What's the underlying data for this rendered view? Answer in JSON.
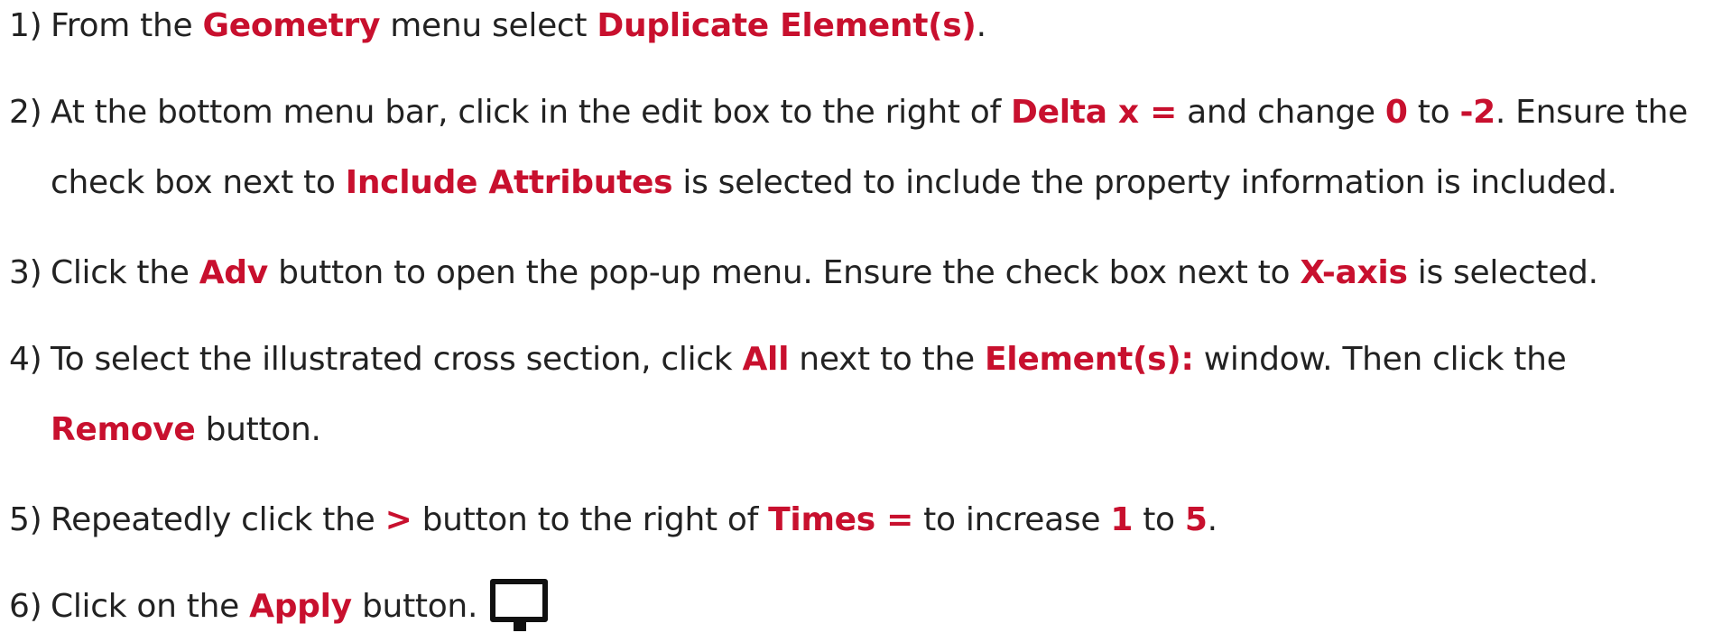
{
  "steps": [
    {
      "num": "1)",
      "lines": [
        [
          {
            "t": "From the "
          },
          {
            "t": "Geometry",
            "hl": true
          },
          {
            "t": " menu select "
          },
          {
            "t": "Duplicate Element(s)",
            "hl": true
          },
          {
            "t": "."
          }
        ]
      ]
    },
    {
      "num": "2)",
      "lines": [
        [
          {
            "t": "At the bottom menu bar, click in the edit box to the right of "
          },
          {
            "t": "Delta x =",
            "hl": true
          },
          {
            "t": " and change "
          },
          {
            "t": "0",
            "hl": true
          },
          {
            "t": " to "
          },
          {
            "t": "-2",
            "hl": true
          },
          {
            "t": ". Ensure the"
          }
        ],
        [
          {
            "t": "check box next to "
          },
          {
            "t": "Include Attributes",
            "hl": true
          },
          {
            "t": " is selected to include the property information is included."
          }
        ]
      ]
    },
    {
      "num": "3)",
      "lines": [
        [
          {
            "t": "Click the "
          },
          {
            "t": "Adv",
            "hl": true
          },
          {
            "t": " button to open the pop-up menu. Ensure the check box next to "
          },
          {
            "t": "X-axis",
            "hl": true
          },
          {
            "t": " is selected."
          }
        ]
      ]
    },
    {
      "num": "4)",
      "lines": [
        [
          {
            "t": "To select the illustrated cross section, click "
          },
          {
            "t": "All",
            "hl": true
          },
          {
            "t": " next to the "
          },
          {
            "t": "Element(s):",
            "hl": true
          },
          {
            "t": " window. Then click the"
          }
        ],
        [
          {
            "t": "Remove",
            "hl": true
          },
          {
            "t": " button."
          }
        ]
      ]
    },
    {
      "num": "5)",
      "lines": [
        [
          {
            "t": "Repeatedly click the "
          },
          {
            "t": ">",
            "hl": true
          },
          {
            "t": " button to the right of "
          },
          {
            "t": "Times =",
            "hl": true
          },
          {
            "t": " to increase "
          },
          {
            "t": "1",
            "hl": true
          },
          {
            "t": " to "
          },
          {
            "t": "5",
            "hl": true
          },
          {
            "t": "."
          }
        ]
      ]
    },
    {
      "num": "6)",
      "lines": [
        [
          {
            "t": "Click on the "
          },
          {
            "t": "Apply",
            "hl": true
          },
          {
            "t": " button."
          }
        ]
      ]
    }
  ],
  "icons": {
    "step6_icon": "monitor-icon"
  },
  "colors": {
    "text": "#222222",
    "highlight": "#c8102e",
    "icon": "#111111"
  }
}
